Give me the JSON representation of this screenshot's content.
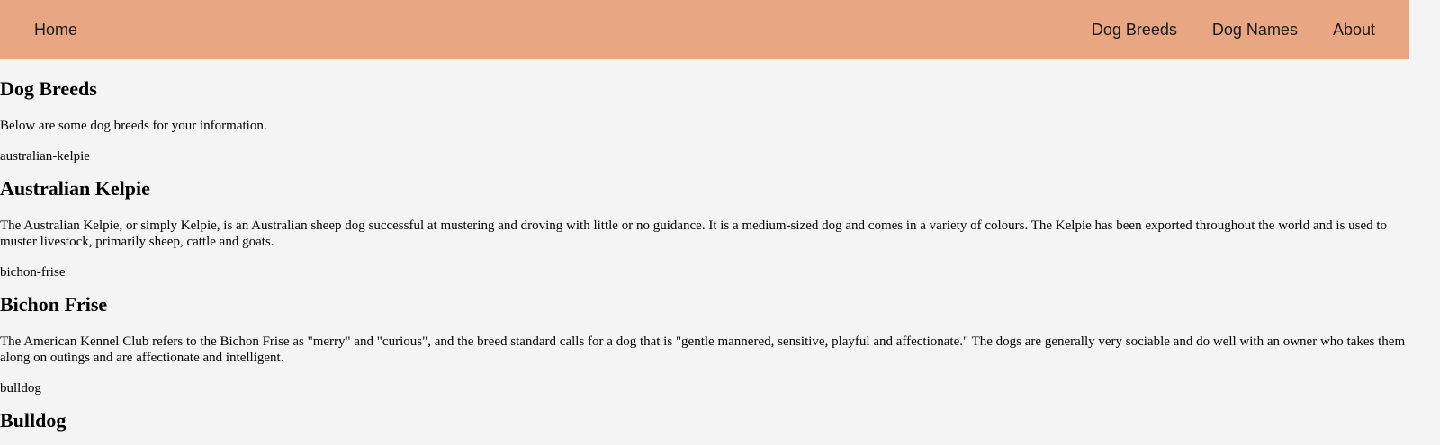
{
  "nav": {
    "home": "Home",
    "links": [
      "Dog Breeds",
      "Dog Names",
      "About"
    ]
  },
  "colors": {
    "navbar_bg": "#e9a683",
    "page_bg": "#f4f4f4"
  },
  "main": {
    "title": "Dog Breeds",
    "intro": "Below are some dog breeds for your information.",
    "breeds": [
      {
        "image_alt": "australian-kelpie",
        "name": "Australian Kelpie",
        "description": "The Australian Kelpie, or simply Kelpie, is an Australian sheep dog successful at mustering and droving with little or no guidance. It is a medium-sized dog and comes in a variety of colours. The Kelpie has been exported throughout the world and is used to muster livestock, primarily sheep, cattle and goats."
      },
      {
        "image_alt": "bichon-frise",
        "name": "Bichon Frise",
        "description": "The American Kennel Club refers to the Bichon Frise as \"merry\" and \"curious\", and the breed standard calls for a dog that is \"gentle mannered, sensitive, playful and affectionate.\" The dogs are generally very sociable and do well with an owner who takes them along on outings and are affectionate and intelligent."
      },
      {
        "image_alt": "bulldog",
        "name": "Bulldog"
      }
    ]
  }
}
